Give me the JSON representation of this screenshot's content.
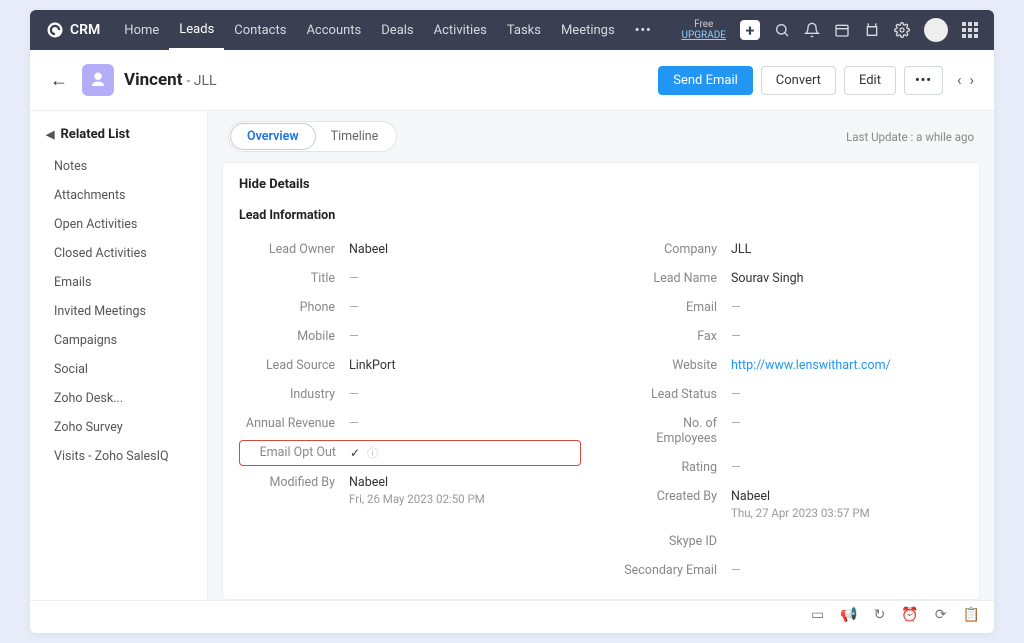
{
  "app": {
    "name": "CRM"
  },
  "nav": {
    "items": [
      "Home",
      "Leads",
      "Contacts",
      "Accounts",
      "Deals",
      "Activities",
      "Tasks",
      "Meetings"
    ],
    "active_index": 1,
    "upgrade_free": "Free",
    "upgrade_link": "UPGRADE"
  },
  "record": {
    "name": "Vincent",
    "company_suffix": "- JLL"
  },
  "actions": {
    "send_email": "Send Email",
    "convert": "Convert",
    "edit": "Edit",
    "more": "•••"
  },
  "sidebar": {
    "header": "Related List",
    "items": [
      "Notes",
      "Attachments",
      "Open Activities",
      "Closed Activities",
      "Emails",
      "Invited Meetings",
      "Campaigns",
      "Social",
      "Zoho Desk...",
      "Zoho Survey",
      "Visits - Zoho SalesIQ"
    ]
  },
  "tabs": {
    "overview": "Overview",
    "timeline": "Timeline"
  },
  "meta": {
    "last_update": "Last Update : a while ago",
    "hide_details": "Hide Details",
    "section_title": "Lead Information"
  },
  "fields": {
    "left": {
      "lead_owner": {
        "label": "Lead Owner",
        "value": "Nabeel"
      },
      "title": {
        "label": "Title",
        "value": "—"
      },
      "phone": {
        "label": "Phone",
        "value": "—"
      },
      "mobile": {
        "label": "Mobile",
        "value": "—"
      },
      "lead_source": {
        "label": "Lead Source",
        "value": "LinkPort"
      },
      "industry": {
        "label": "Industry",
        "value": "—"
      },
      "annual_revenue": {
        "label": "Annual Revenue",
        "value": "—"
      },
      "email_opt_out": {
        "label": "Email Opt Out",
        "value": "✓"
      },
      "modified_by": {
        "label": "Modified By",
        "value": "Nabeel",
        "meta": "Fri, 26 May 2023 02:50 PM"
      }
    },
    "right": {
      "company": {
        "label": "Company",
        "value": "JLL"
      },
      "lead_name": {
        "label": "Lead Name",
        "value": "Sourav Singh"
      },
      "email": {
        "label": "Email",
        "value": "—"
      },
      "fax": {
        "label": "Fax",
        "value": "—"
      },
      "website": {
        "label": "Website",
        "value": "http://www.lenswithart.com/"
      },
      "lead_status": {
        "label": "Lead Status",
        "value": "—"
      },
      "employees": {
        "label": "No. of Employees",
        "value": "—"
      },
      "rating": {
        "label": "Rating",
        "value": "—"
      },
      "created_by": {
        "label": "Created By",
        "value": "Nabeel",
        "meta": "Thu, 27 Apr 2023 03:57 PM"
      },
      "skype_id": {
        "label": "Skype ID",
        "value": ""
      },
      "secondary_email": {
        "label": "Secondary Email",
        "value": "—"
      }
    }
  }
}
